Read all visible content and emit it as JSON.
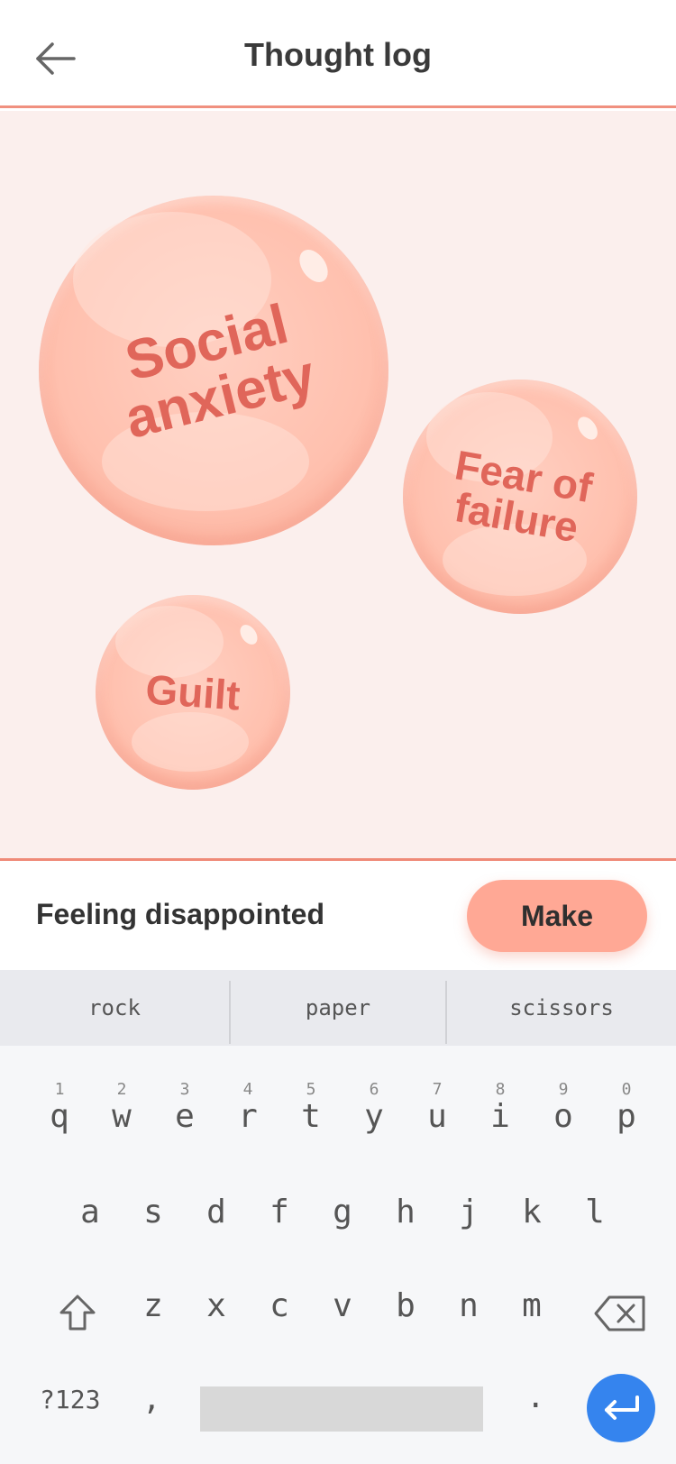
{
  "header": {
    "title": "Thought log",
    "back_icon": "arrow-left-icon"
  },
  "bubbles": [
    {
      "label_line1": "Social",
      "label_line2": "anxiety"
    },
    {
      "label_line1": "Fear of",
      "label_line2": "failure"
    },
    {
      "label_line1": "Guilt"
    }
  ],
  "input": {
    "feeling": "Feeling disappointed",
    "make_label": "Make"
  },
  "keyboard": {
    "suggestions": [
      "rock",
      "paper",
      "scissors"
    ],
    "row1": [
      {
        "hint": "1",
        "key": "q"
      },
      {
        "hint": "2",
        "key": "w"
      },
      {
        "hint": "3",
        "key": "e"
      },
      {
        "hint": "4",
        "key": "r"
      },
      {
        "hint": "5",
        "key": "t"
      },
      {
        "hint": "6",
        "key": "y"
      },
      {
        "hint": "7",
        "key": "u"
      },
      {
        "hint": "8",
        "key": "i"
      },
      {
        "hint": "9",
        "key": "o"
      },
      {
        "hint": "0",
        "key": "p"
      }
    ],
    "row2": [
      "a",
      "s",
      "d",
      "f",
      "g",
      "h",
      "j",
      "k",
      "l"
    ],
    "row3": [
      "z",
      "x",
      "c",
      "v",
      "b",
      "n",
      "m"
    ],
    "symbols_label": "?123",
    "comma_label": ",",
    "period_label": ".",
    "accent_color": "#3584ee"
  },
  "colors": {
    "bubble_text": "#e0665a",
    "bubble_fill": "#ffc0ae",
    "area_bg": "#fbefed",
    "make_button": "#ffa895"
  }
}
